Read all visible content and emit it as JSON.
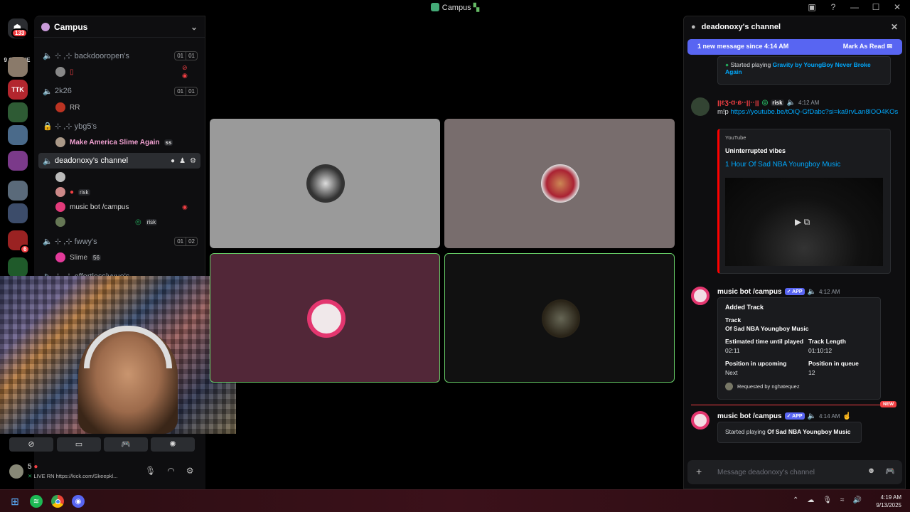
{
  "window": {
    "title": "Campus",
    "controls": [
      "—",
      "☐",
      "✕"
    ]
  },
  "server_rail": {
    "online_text": "9 ONLINE",
    "badge_top": "133",
    "badge_red": "6"
  },
  "server": {
    "name": "Campus"
  },
  "voice_channels": [
    {
      "name": "⊹ ,⊹ backdooropen's",
      "count_a": "01",
      "count_b": "01",
      "users": [
        {
          "name": "",
          "tag": ""
        }
      ]
    },
    {
      "name": "2k26",
      "count_a": "01",
      "count_b": "01",
      "users": [
        {
          "name": "RR"
        }
      ]
    },
    {
      "name": "⊹ ,⊹ ybg5's",
      "users": [
        {
          "name": "Make America Slime Again",
          "extra": "ss"
        }
      ]
    },
    {
      "name": "deadonoxy's channel",
      "users": [
        {
          "name": ""
        },
        {
          "name": "",
          "tag": "risk"
        },
        {
          "name": "music bot /campus"
        },
        {
          "name": "",
          "tag": "risk"
        }
      ]
    },
    {
      "name": "⊹ ,⊹ fwwy's",
      "count_a": "01",
      "count_b": "02",
      "users": [
        {
          "name": "Slime",
          "extra": "56"
        }
      ]
    },
    {
      "name": "⊹ ,⊹ effortlesslyyue's"
    }
  ],
  "user_panel": {
    "name": "5",
    "status": "LIVE RN https://kick.com/Skeepkl..."
  },
  "chat": {
    "channel_title": "deadonoxy's channel",
    "new_bar": {
      "text": "1 new message since 4:14 AM",
      "action": "Mark As Read"
    },
    "prev_embed": {
      "prefix": "Started playing ",
      "track": "Gravity by YoungBoy Never Broke Again"
    },
    "msg1": {
      "author": "ꞁꞁɛʒ-ɑ·ɕ··ꞁꞁ··ꞁꞁ",
      "tag": "risk",
      "time": "4:12 AM",
      "cmd": "m!p ",
      "link": "https://youtube.be/tOiQ-GfDabc?si=ka9rvLan8lOO4KOs",
      "yt_provider": "YouTube",
      "yt_author": "Uninterrupted vibes",
      "yt_title": "1 Hour Of Sad NBA Youngboy Music"
    },
    "msg2": {
      "author": "music bot /campus",
      "app": "APP",
      "time": "4:12 AM",
      "heading": "Added Track",
      "track_label": "Track",
      "track": "Of Sad NBA Youngboy Music",
      "est_label": "Estimated time until played",
      "est": "02:11",
      "len_label": "Track Length",
      "len": "01:10:12",
      "pos_up_label": "Position in upcoming",
      "pos_up": "Next",
      "pos_q_label": "Position in queue",
      "pos_q": "12",
      "requested": "Requested by nghatequez"
    },
    "new_label": "NEW",
    "msg3": {
      "author": "music bot /campus",
      "app": "APP",
      "time": "4:14 AM",
      "prefix": "Started playing ",
      "track": "Of Sad NBA Youngboy Music"
    },
    "input_placeholder": "Message deadonoxy's channel"
  },
  "taskbar": {
    "time": "4:19 AM",
    "date": "9/13/2025"
  }
}
